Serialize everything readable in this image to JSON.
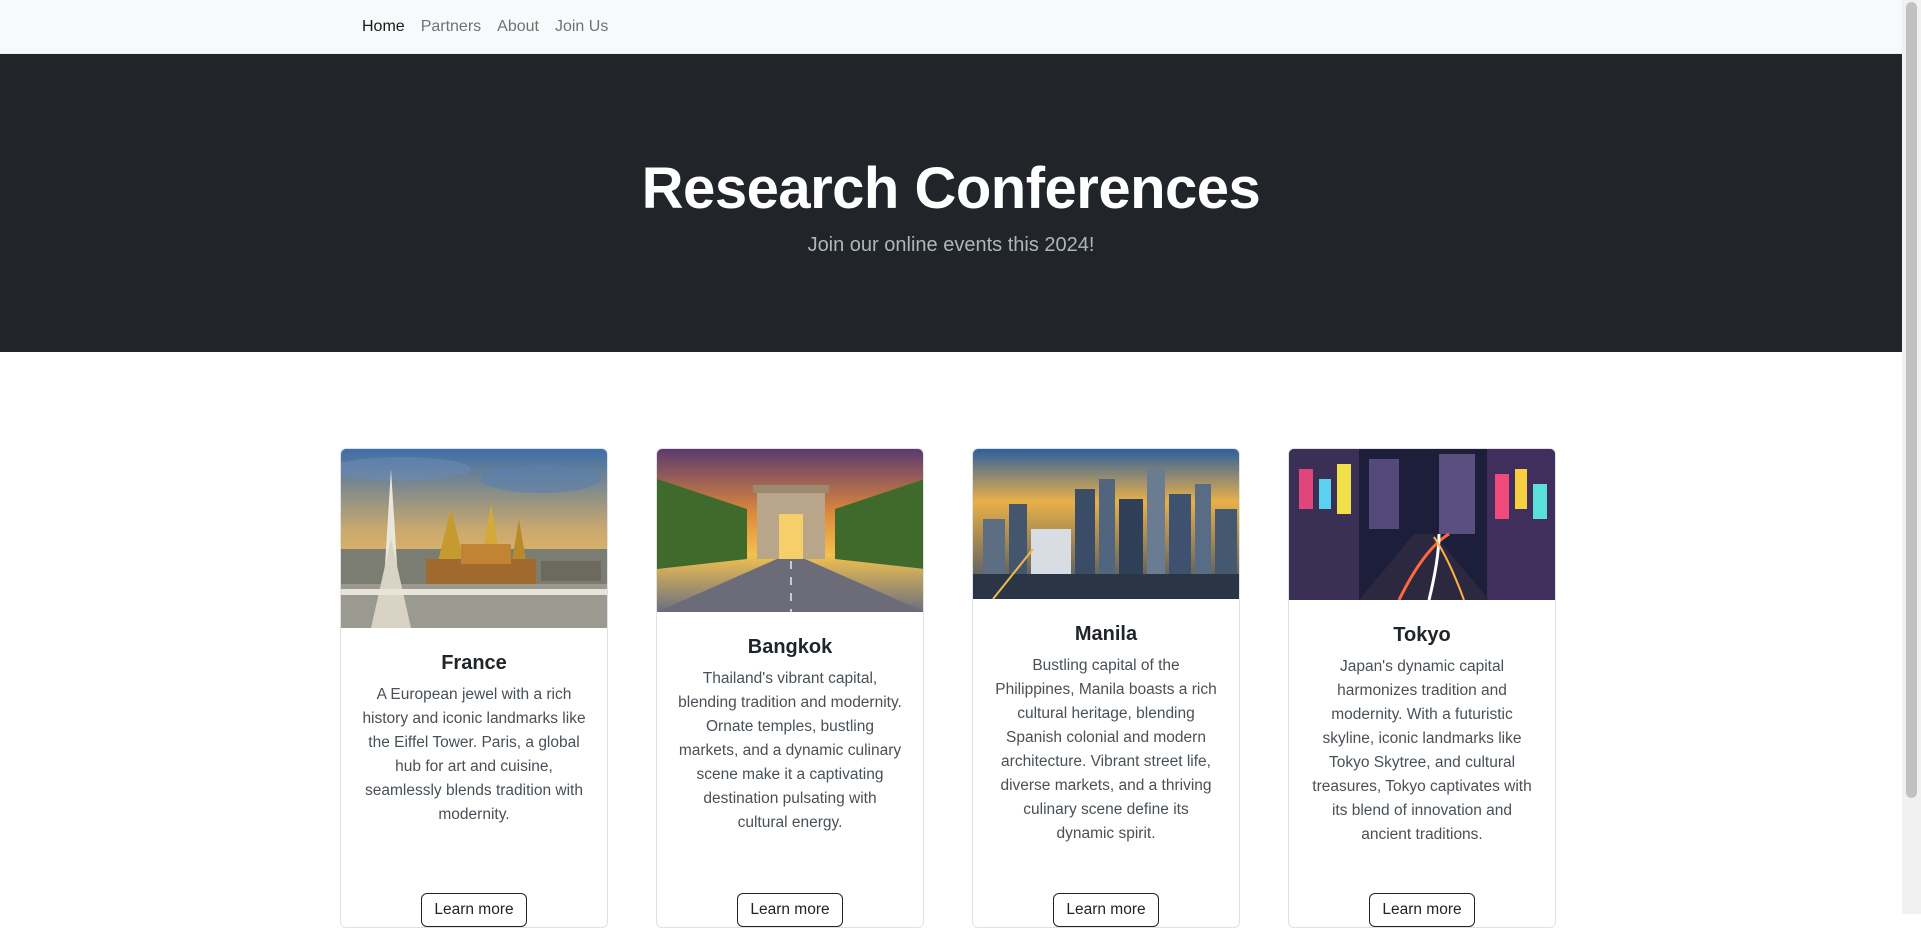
{
  "nav": {
    "items": [
      {
        "label": "Home",
        "active": true
      },
      {
        "label": "Partners",
        "active": false
      },
      {
        "label": "About",
        "active": false
      },
      {
        "label": "Join Us",
        "active": false
      }
    ]
  },
  "hero": {
    "title": "Research Conferences",
    "subtitle": "Join our online events this 2024!"
  },
  "cards": [
    {
      "title": "France",
      "text": "A European jewel with a rich history and iconic landmarks like the Eiffel Tower. Paris, a global hub for art and cuisine, seamlessly blends tradition with modernity.",
      "button": "Learn more"
    },
    {
      "title": "Bangkok",
      "text": "Thailand's vibrant capital, blending tradition and modernity. Ornate temples, bustling markets, and a dynamic culinary scene make it a captivating destination pulsating with cultural energy.",
      "button": "Learn more"
    },
    {
      "title": "Manila",
      "text": "Bustling capital of the Philippines, Manila boasts a rich cultural heritage, blending Spanish colonial and modern architecture. Vibrant street life, diverse markets, and a thriving culinary scene define its dynamic spirit.",
      "button": "Learn more"
    },
    {
      "title": "Tokyo",
      "text": "Japan's dynamic capital harmonizes tradition and modernity. With a futuristic skyline, iconic landmarks like Tokyo Skytree, and cultural treasures, Tokyo captivates with its blend of innovation and ancient traditions.",
      "button": "Learn more"
    }
  ],
  "colors": {
    "hero_bg": "#212529",
    "nav_bg": "#f8f9fa"
  }
}
